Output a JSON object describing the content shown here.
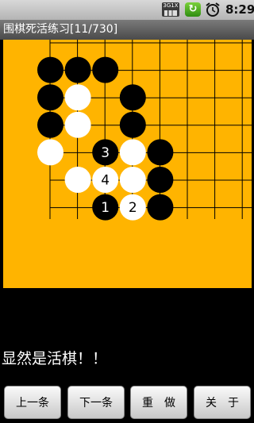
{
  "status_bar": {
    "network_label": "3G1X",
    "sync_icon": "sync-icon",
    "alarm_icon": "alarm-clock-icon",
    "time": "8:29"
  },
  "title": "围棋死活练习[11/730]",
  "board": {
    "size": 10,
    "colors": {
      "board": "#ffb400",
      "line": "#000000",
      "black": "#000000",
      "white": "#ffffff"
    },
    "stones": [
      {
        "col": 1,
        "row": 1,
        "color": "black"
      },
      {
        "col": 2,
        "row": 1,
        "color": "black"
      },
      {
        "col": 3,
        "row": 1,
        "color": "black"
      },
      {
        "col": 1,
        "row": 2,
        "color": "black"
      },
      {
        "col": 2,
        "row": 2,
        "color": "white"
      },
      {
        "col": 4,
        "row": 2,
        "color": "black"
      },
      {
        "col": 1,
        "row": 3,
        "color": "black"
      },
      {
        "col": 2,
        "row": 3,
        "color": "white"
      },
      {
        "col": 4,
        "row": 3,
        "color": "black"
      },
      {
        "col": 1,
        "row": 4,
        "color": "white"
      },
      {
        "col": 3,
        "row": 4,
        "color": "black",
        "label": "3"
      },
      {
        "col": 4,
        "row": 4,
        "color": "white"
      },
      {
        "col": 5,
        "row": 4,
        "color": "black"
      },
      {
        "col": 2,
        "row": 5,
        "color": "white"
      },
      {
        "col": 3,
        "row": 5,
        "color": "white",
        "label": "4"
      },
      {
        "col": 4,
        "row": 5,
        "color": "white"
      },
      {
        "col": 5,
        "row": 5,
        "color": "black"
      },
      {
        "col": 3,
        "row": 6,
        "color": "black",
        "label": "1"
      },
      {
        "col": 4,
        "row": 6,
        "color": "white",
        "label": "2"
      },
      {
        "col": 5,
        "row": 6,
        "color": "black"
      }
    ]
  },
  "message": "显然是活棋！！",
  "buttons": {
    "prev": "上一条",
    "next": "下一条",
    "reset": "重　做",
    "about": "关　于"
  }
}
